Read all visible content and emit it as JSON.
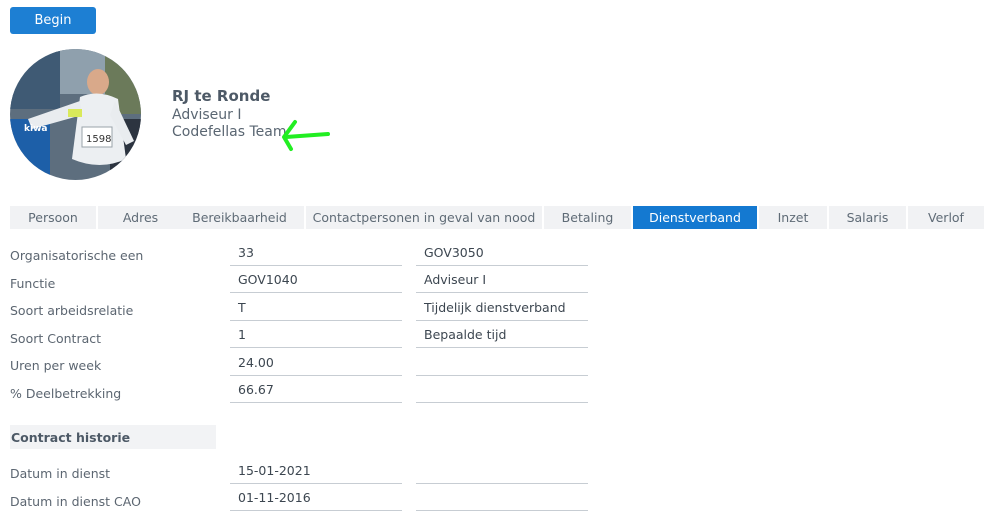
{
  "header": {
    "begin_label": "Begin"
  },
  "profile": {
    "name": "RJ te Ronde",
    "role": "Adviseur I",
    "team": "Codefellas Team",
    "bib_text": "1598",
    "shirt_text": "kiwa"
  },
  "tabs": [
    {
      "label": "Persoon",
      "active": false
    },
    {
      "label": "Adres",
      "active": false
    },
    {
      "label": "Bereikbaarheid",
      "active": false
    },
    {
      "label": "Contactpersonen in geval van nood",
      "active": false
    },
    {
      "label": "Betaling",
      "active": false
    },
    {
      "label": "Dienstverband",
      "active": true
    },
    {
      "label": "Inzet",
      "active": false
    },
    {
      "label": "Salaris",
      "active": false
    },
    {
      "label": "Verlof",
      "active": false
    }
  ],
  "rows": [
    {
      "label": "Organisatorische een",
      "value1": "33",
      "value2": "GOV3050"
    },
    {
      "label": "Functie",
      "value1": "GOV1040",
      "value2": "Adviseur I"
    },
    {
      "label": "Soort arbeidsrelatie",
      "value1": "T",
      "value2": "Tijdelijk dienstverband"
    },
    {
      "label": "Soort Contract",
      "value1": "1",
      "value2": "Bepaalde tijd"
    },
    {
      "label": "Uren per week",
      "value1": "24.00",
      "value2": ""
    },
    {
      "label": "% Deelbetrekking",
      "value1": "66.67",
      "value2": ""
    }
  ],
  "history": {
    "title": "Contract historie",
    "rows": [
      {
        "label": "Datum in dienst",
        "value1": "15-01-2021",
        "value2": ""
      },
      {
        "label": "Datum in dienst CAO",
        "value1": "01-11-2016",
        "value2": ""
      }
    ]
  },
  "colors": {
    "accent": "#1479d1",
    "button": "#1d7fd3",
    "tab_bg": "#f1f2f4",
    "annotation_arrow": "#22ee22"
  }
}
